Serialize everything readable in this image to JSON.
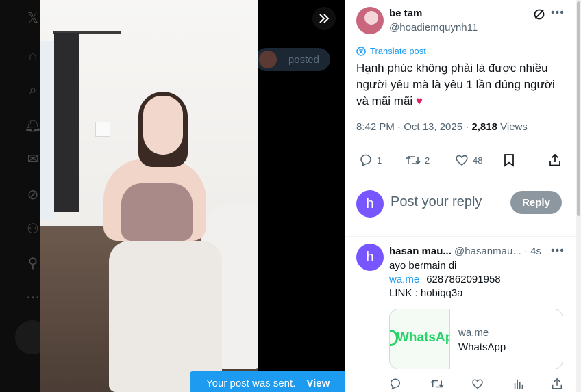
{
  "post": {
    "author_name": "be tam",
    "author_handle": "@hoadiemquynh11",
    "translate_label": "Translate post",
    "text": "Hạnh phúc không phải là được nhiều người yêu mà là yêu 1 lần đúng người và mãi mãi",
    "heart_emoji": "♥",
    "time": "8:42 PM · Oct 13, 2025 · ",
    "views_count": "2,818",
    "views_label": " Views",
    "stats": {
      "replies": "1",
      "reposts": "2",
      "likes": "48"
    }
  },
  "reply_box": {
    "avatar_letter": "h",
    "placeholder": "Post your reply",
    "button_label": "Reply"
  },
  "comment": {
    "avatar_letter": "h",
    "name": "hasan mau...",
    "handle": " @hasanmau...",
    "time": " · 4s",
    "line1": "ayo bermain di",
    "link_text": "wa.me",
    "phone": "6287862091958",
    "line3": "LINK : hobiqq3a",
    "card": {
      "thumb_text": "WhatsApp",
      "domain": "wa.me",
      "title": "WhatsApp"
    }
  },
  "background": {
    "pill_text": "posted"
  },
  "toast": {
    "message": "Your post was sent.",
    "action": "View"
  },
  "colors": {
    "accent": "#1d9bf0",
    "avatar_purple": "#7856ff",
    "heart": "#e0245e"
  }
}
